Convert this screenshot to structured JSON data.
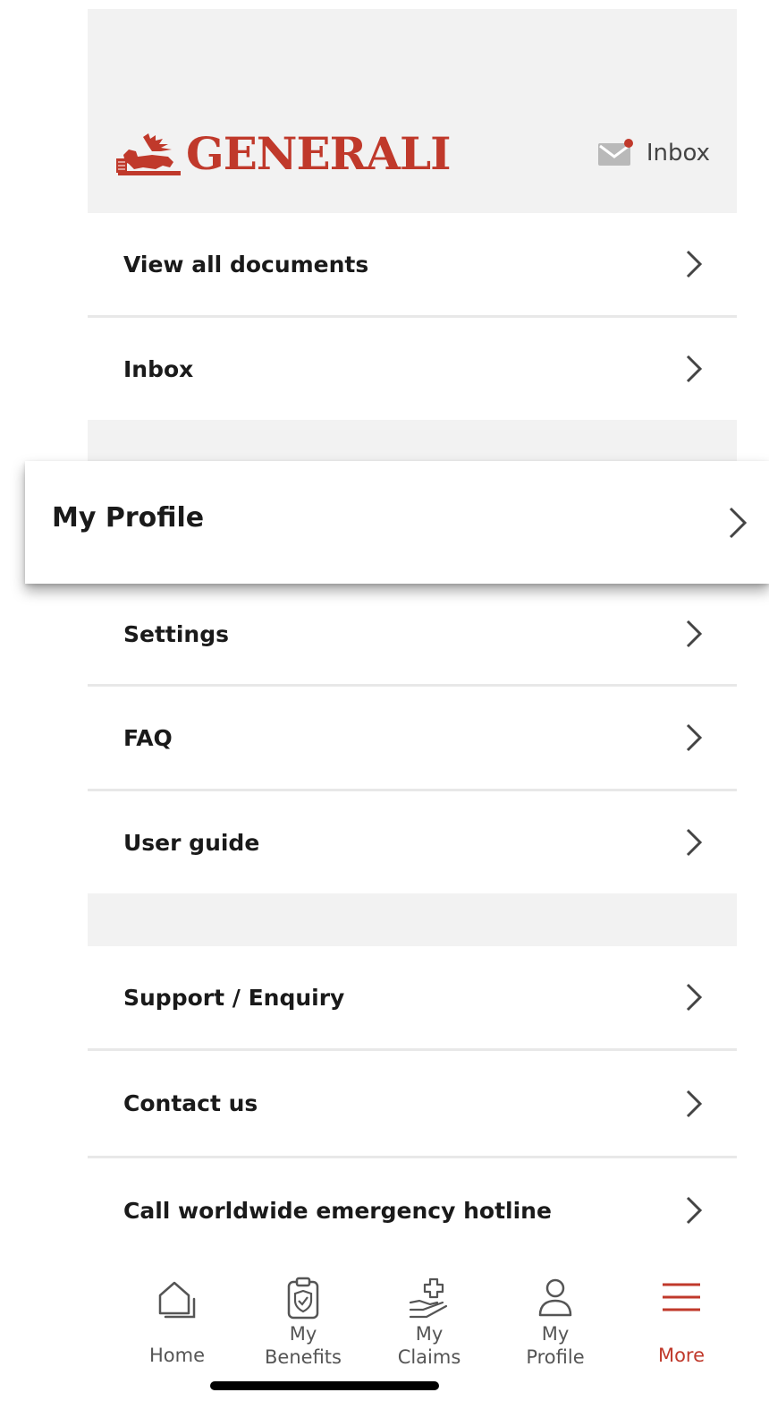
{
  "brand": {
    "name": "GENERALI",
    "color": "#c0392b"
  },
  "header": {
    "inbox_label": "Inbox",
    "inbox_icon": "mail-icon",
    "has_unread": true
  },
  "menu": {
    "view_all_documents": "View all documents",
    "inbox": "Inbox",
    "my_profile": "My Profile",
    "settings": "Settings",
    "faq": "FAQ",
    "user_guide": "User guide",
    "support_enquiry": "Support / Enquiry",
    "contact_us": "Contact us",
    "emergency_hotline": "Call worldwide emergency hotline"
  },
  "tabs": [
    {
      "line1": "Home",
      "line2": "",
      "icon": "home-icon",
      "active": false
    },
    {
      "line1": "My",
      "line2": "Benefits",
      "icon": "benefits-icon",
      "active": false
    },
    {
      "line1": "My",
      "line2": "Claims",
      "icon": "claims-icon",
      "active": false
    },
    {
      "line1": "My",
      "line2": "Profile",
      "icon": "profile-icon",
      "active": false
    },
    {
      "line1": "More",
      "line2": "",
      "icon": "menu-icon",
      "active": true
    }
  ],
  "colors": {
    "accent": "#c0392b",
    "header_bg": "#f2f2f2",
    "text": "#1a1a1a"
  }
}
